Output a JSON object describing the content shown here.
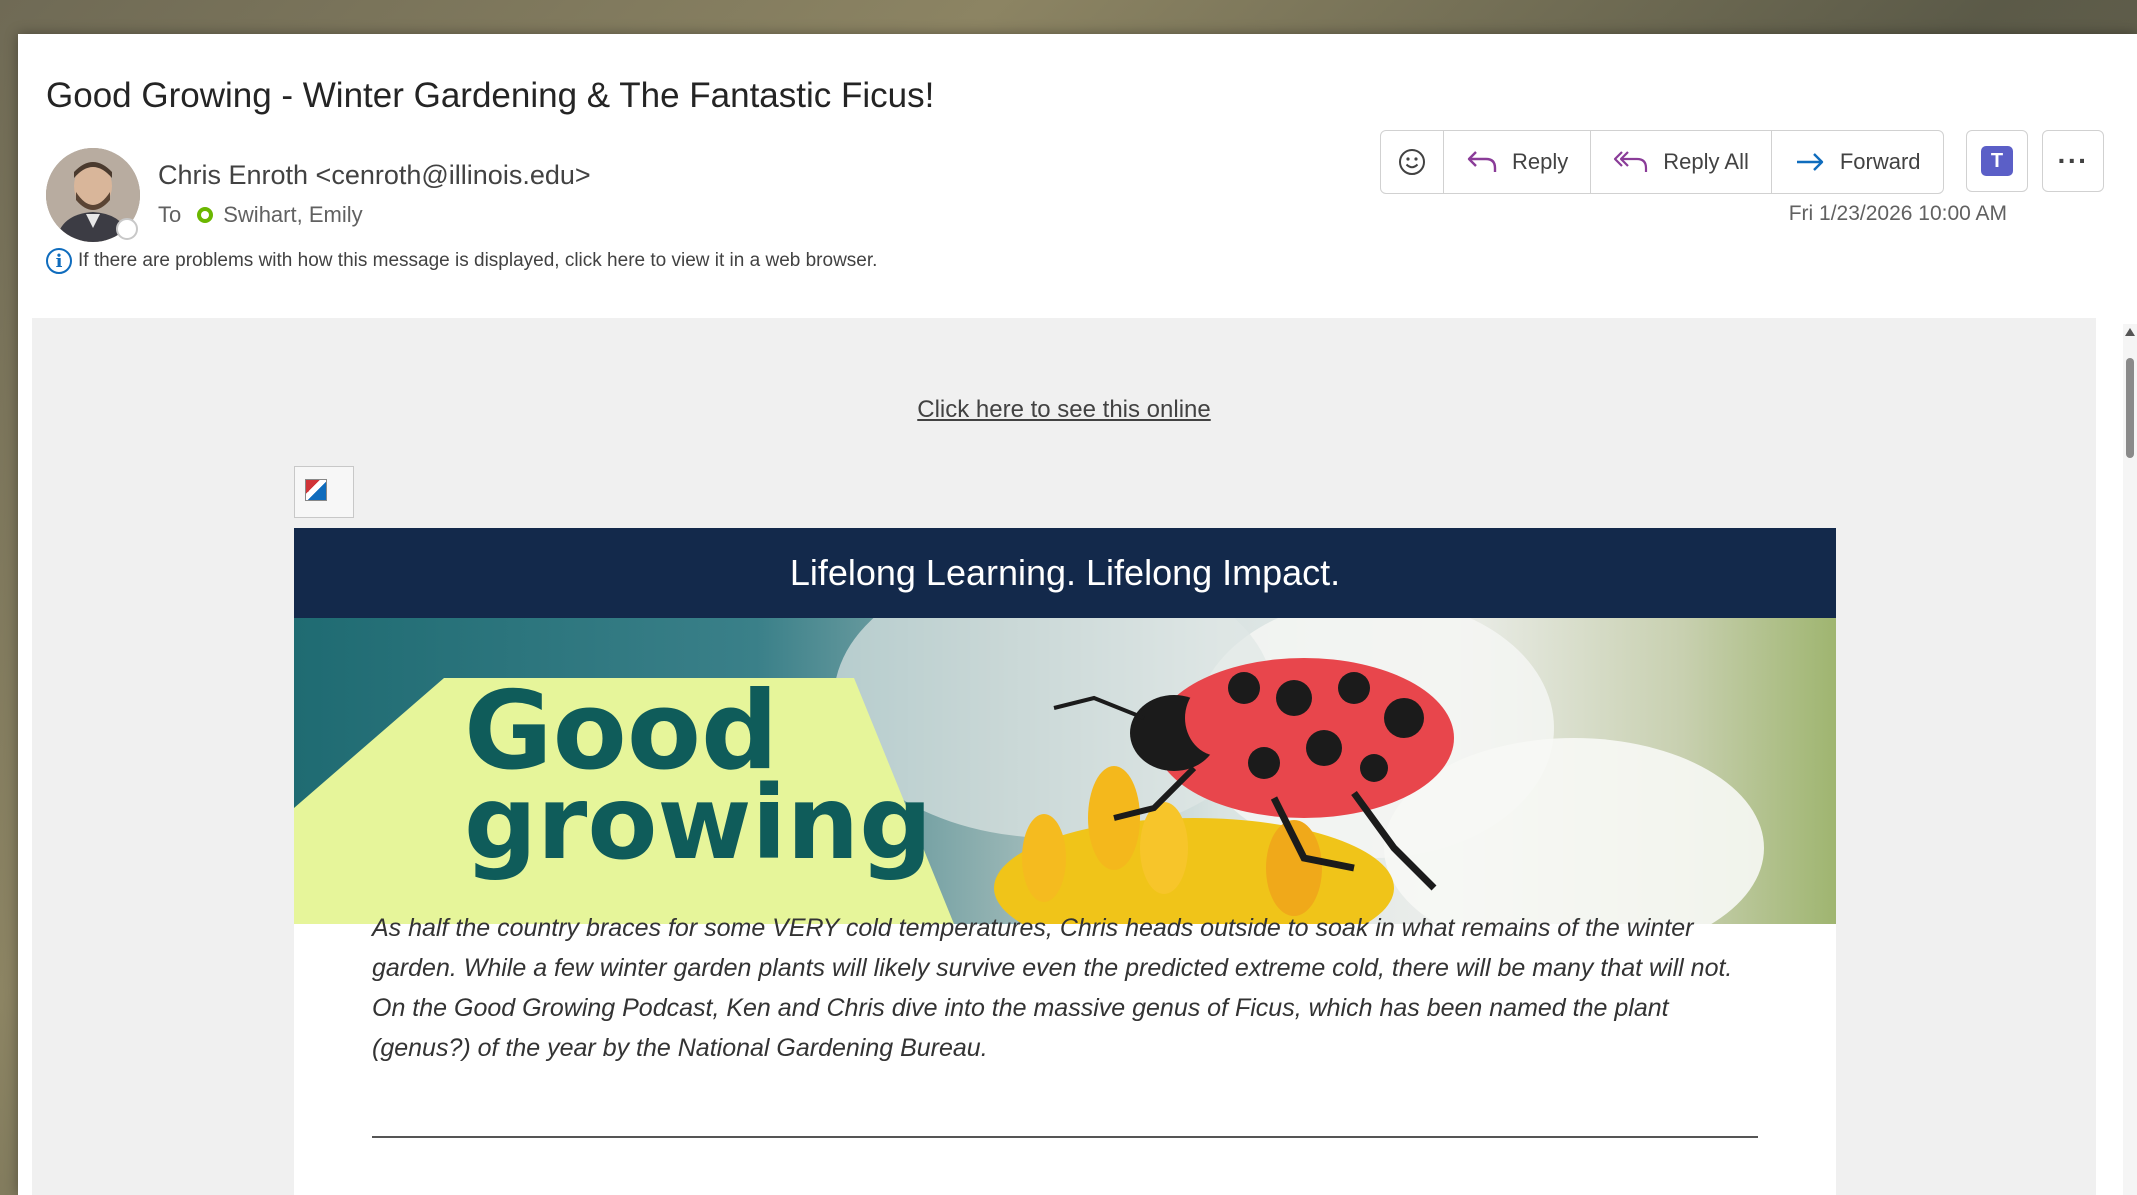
{
  "email": {
    "subject": "Good Growing - Winter Gardening & The Fantastic Ficus!",
    "sender": "Chris Enroth <cenroth@illinois.edu>",
    "to_label": "To",
    "recipient": "Swihart, Emily",
    "info_message": "If there are problems with how this message is displayed, click here to view it in a web browser.",
    "date": "Fri 1/23/2026 10:00 AM"
  },
  "toolbar": {
    "reply_label": "Reply",
    "reply_all_label": "Reply All",
    "forward_label": "Forward",
    "more_label": "···"
  },
  "newsletter": {
    "online_link": "Click here to see this online",
    "banner": "Lifelong Learning. Lifelong Impact.",
    "hero_title_line1": "Good",
    "hero_title_line2": "growing",
    "intro": "As half the country braces for some VERY cold temperatures, Chris heads outside to soak in what remains of the winter garden. While a few winter garden plants will likely survive even the predicted extreme cold, there will be many that will not. On the Good Growing Podcast, Ken and Chris dive into the massive genus of Ficus, which has been named the plant (genus?) of the year by the National Gardening Bureau."
  },
  "colors": {
    "banner_bg": "#13294b",
    "hero_title": "#0f5c5a",
    "hero_accent": "#e6f59a",
    "link": "#0f6cbd"
  }
}
